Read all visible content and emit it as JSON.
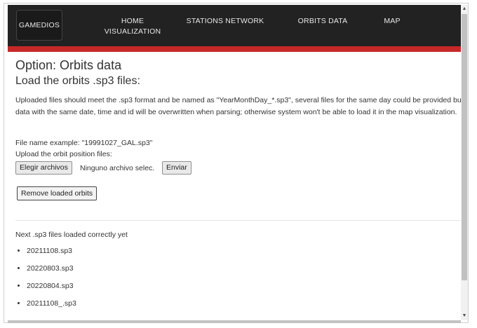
{
  "nav": {
    "brand": "GAMEDIOS",
    "items": [
      {
        "label_line1": "HOME",
        "label_line2": "VISUALIZATION"
      },
      {
        "label_line1": "STATIONS NETWORK"
      },
      {
        "label_line1": "ORBITS DATA"
      },
      {
        "label_line1": "MAP"
      }
    ]
  },
  "page": {
    "option_title": "Option: Orbits data",
    "section_title": "Load the orbits .sp3 files:",
    "description": "Uploaded files should meet the .sp3 format and be named as \"YearMonthDay_*.sp3\", several files for the same day could be provided but data with the same date, time and id will be overwritten when parsing; otherwise system won't be able to load it in the map visualization.",
    "example": "File name example: \"19991027_GAL.sp3\"",
    "upload_label": "Upload the orbit position files:",
    "choose_files_button": "Elegir archivos",
    "no_file_text": "Ninguno archivo selec.",
    "send_button": "Enviar",
    "remove_button": "Remove loaded orbits",
    "loaded_heading": "Next .sp3 files loaded correctly yet",
    "loaded_files": [
      "20211108.sp3",
      "20220803.sp3",
      "20220804.sp3",
      "20211108_.sp3"
    ]
  },
  "colors": {
    "navbar": "#222222",
    "accent": "#c62828"
  }
}
